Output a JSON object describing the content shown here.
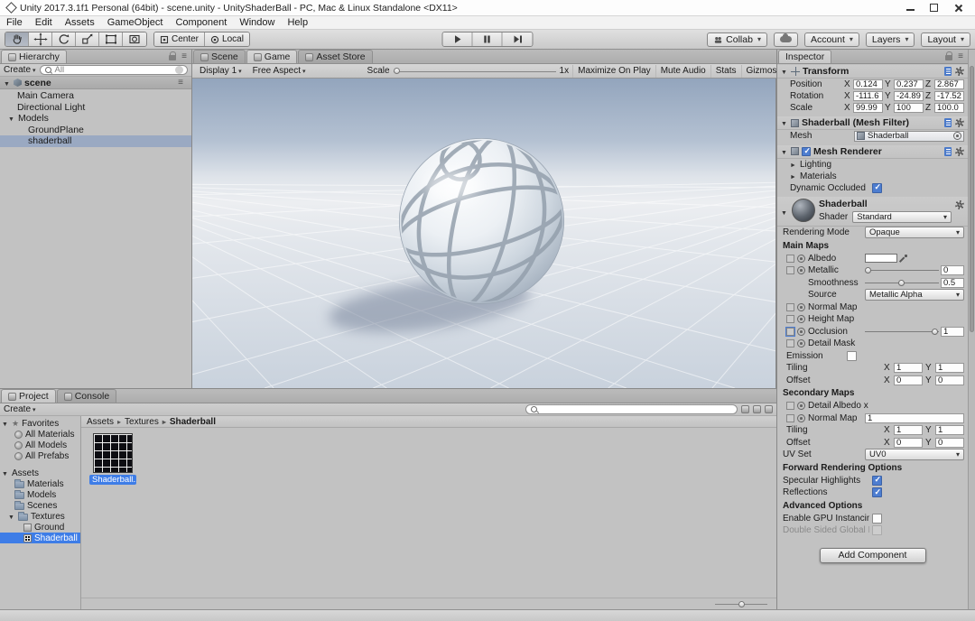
{
  "titlebar": {
    "title": "Unity 2017.3.1f1 Personal (64bit) - scene.unity - UnityShaderBall - PC, Mac & Linux Standalone <DX11>"
  },
  "menubar": {
    "items": [
      "File",
      "Edit",
      "Assets",
      "GameObject",
      "Component",
      "Window",
      "Help"
    ]
  },
  "toolbar": {
    "pivot_label": "Center",
    "space_label": "Local",
    "collab_label": "Collab",
    "account_label": "Account",
    "layers_label": "Layers",
    "layout_label": "Layout"
  },
  "hierarchy": {
    "tab_label": "Hierarchy",
    "create_label": "Create",
    "search_filter": "All",
    "scene_label": "scene",
    "items": [
      {
        "label": "Main Camera"
      },
      {
        "label": "Directional Light"
      },
      {
        "label": "Models"
      },
      {
        "label": "GroundPlane"
      },
      {
        "label": "shaderball"
      }
    ]
  },
  "viewport": {
    "scene_tab": "Scene",
    "game_tab": "Game",
    "store_tab": "Asset Store",
    "display": "Display 1",
    "aspect": "Free Aspect",
    "scale_label": "Scale",
    "scale_value": "1x",
    "maximize": "Maximize On Play",
    "mute": "Mute Audio",
    "stats": "Stats",
    "gizmos": "Gizmos"
  },
  "project": {
    "project_tab": "Project",
    "console_tab": "Console",
    "create_label": "Create",
    "favorites_label": "Favorites",
    "favorites": [
      {
        "label": "All Materials"
      },
      {
        "label": "All Models"
      },
      {
        "label": "All Prefabs"
      }
    ],
    "assets_label": "Assets",
    "folders": [
      {
        "label": "Materials"
      },
      {
        "label": "Models"
      },
      {
        "label": "Scenes"
      },
      {
        "label": "Textures"
      }
    ],
    "texture_children": [
      {
        "label": "Ground"
      },
      {
        "label": "Shaderball"
      }
    ],
    "breadcrumb": [
      {
        "label": "Assets"
      },
      {
        "label": "Textures"
      },
      {
        "label": "Shaderball"
      }
    ],
    "asset_name": "Shaderball..."
  },
  "inspector": {
    "tab_label": "Inspector",
    "transform": {
      "title": "Transform",
      "axis_x": "X",
      "axis_y": "Y",
      "axis_z": "Z",
      "rows": [
        {
          "label": "Position",
          "x": "0.124",
          "y": "0.237",
          "z": "2.867"
        },
        {
          "label": "Rotation",
          "x": "-111.6",
          "y": "-24.89",
          "z": "-17.52"
        },
        {
          "label": "Scale",
          "x": "99.99",
          "y": "100",
          "z": "100.0"
        }
      ]
    },
    "mesh_filter": {
      "title": "Shaderball (Mesh Filter)",
      "mesh_label": "Mesh",
      "mesh_value": "Shaderball"
    },
    "mesh_renderer": {
      "title": "Mesh Renderer",
      "lighting": "Lighting",
      "materials": "Materials",
      "dynamic_occluded": "Dynamic Occluded"
    },
    "material": {
      "name": "Shaderball",
      "shader_label": "Shader",
      "shader_value": "Standard",
      "rendering_mode_label": "Rendering Mode",
      "rendering_mode_value": "Opaque",
      "main_maps_title": "Main Maps",
      "albedo": "Albedo",
      "metallic": "Metallic",
      "metallic_value": "0",
      "smoothness": "Smoothness",
      "smoothness_value": "0.5",
      "source": "Source",
      "source_value": "Metallic Alpha",
      "normal_map": "Normal Map",
      "height_map": "Height Map",
      "occlusion": "Occlusion",
      "occlusion_value": "1",
      "detail_mask": "Detail Mask",
      "emission": "Emission",
      "tiling": "Tiling",
      "offset": "Offset",
      "tiling_x": "1",
      "tiling_y": "1",
      "offset_x": "0",
      "offset_y": "0",
      "secondary_maps_title": "Secondary Maps",
      "detail_albedo": "Detail Albedo x",
      "secondary_normal": "Normal Map",
      "secondary_normal_value": "1",
      "secondary_tiling_x": "1",
      "secondary_tiling_y": "1",
      "secondary_offset_x": "0",
      "secondary_offset_y": "0",
      "uv_set": "UV Set",
      "uv_set_value": "UV0",
      "forward_title": "Forward Rendering Options",
      "specular": "Specular Highlights",
      "reflections": "Reflections",
      "advanced_title": "Advanced Options",
      "gpu_instancing": "Enable GPU Instancing",
      "double_sided": "Double Sided Global Illumination"
    },
    "add_component": "Add Component"
  },
  "colors": {
    "selection_blue": "#3e7de7",
    "checkbox_blue": "#4d7dd0",
    "hierarchy_selection": "#9aa9c2",
    "panel_gray": "#c2c2c2"
  }
}
